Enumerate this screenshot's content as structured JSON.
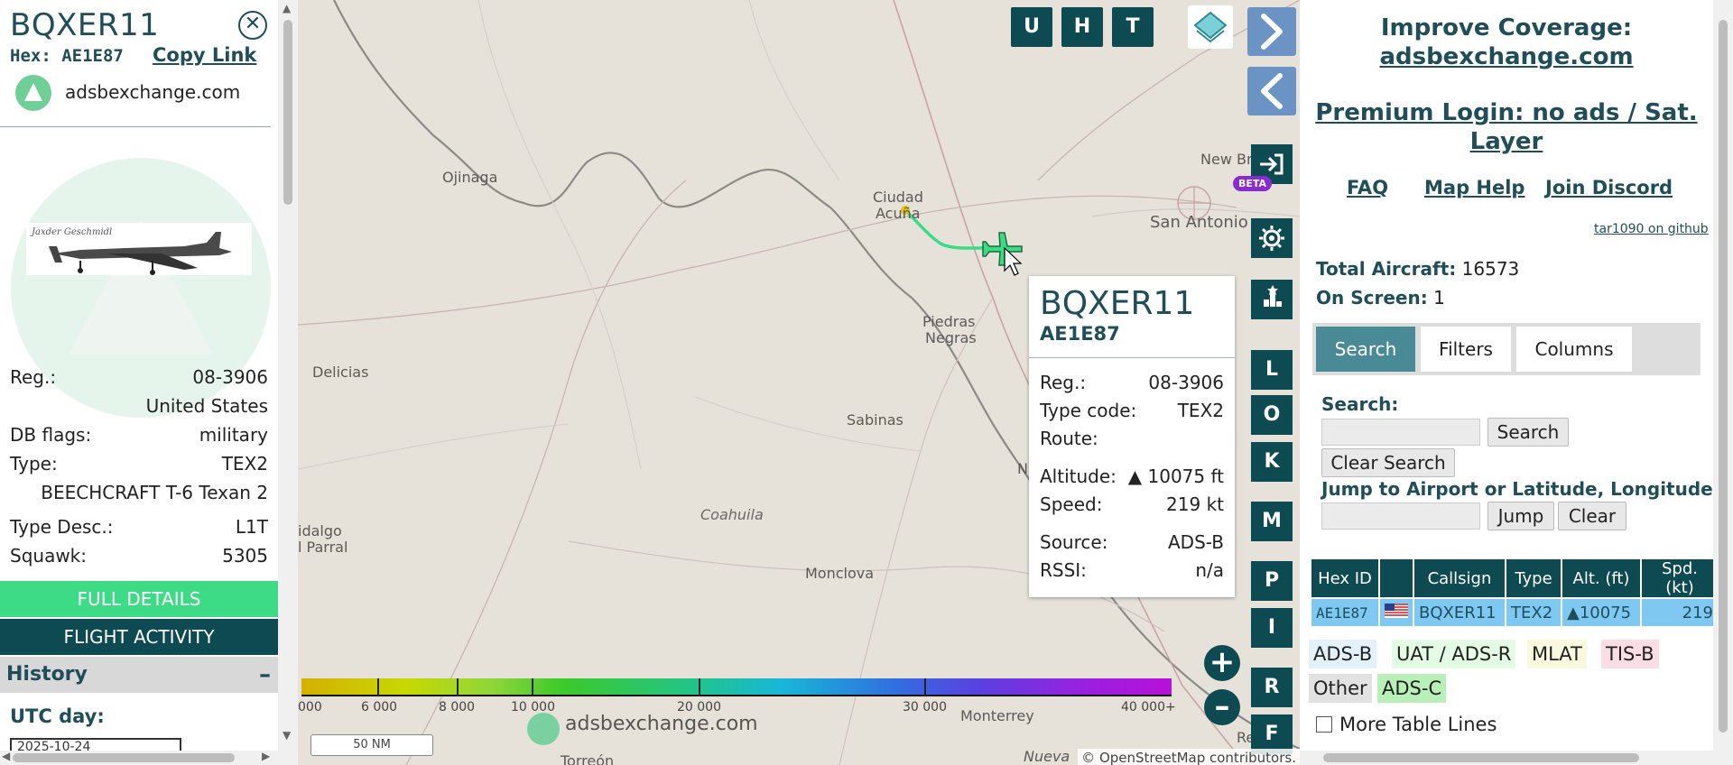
{
  "left_panel": {
    "callsign": "BQXER11",
    "hex_label": "Hex: AE1E87",
    "copy_link": "Copy Link",
    "source_name": "adsbexchange.com",
    "photo_watermark": "Jaxder Geschmidl",
    "rows": [
      {
        "label": "Reg.:",
        "value": "08-3906"
      },
      {
        "label": "",
        "value": "United States"
      },
      {
        "label": "DB flags:",
        "value": "military"
      },
      {
        "label": "Type:",
        "value": "TEX2"
      },
      {
        "label": "",
        "value": "BEECHCRAFT T-6 Texan 2"
      },
      {
        "label": "Type Desc.:",
        "value": "L1T"
      },
      {
        "label": "Squawk:",
        "value": "5305"
      }
    ],
    "full_details": "FULL DETAILS",
    "flight_activity": "FLIGHT ACTIVITY",
    "history": "History",
    "history_toggle": "–",
    "utc_day": "UTC day:",
    "utc_value": "2025-10-24"
  },
  "map": {
    "top_buttons": [
      "U",
      "H",
      "T"
    ],
    "side_buttons": [
      "L",
      "O",
      "K",
      "M",
      "P",
      "I",
      "R",
      "F"
    ],
    "beta": "BETA",
    "zoom_in": "+",
    "zoom_out": "–",
    "cities": [
      "Ojinaga",
      "Ciudad",
      "Acuña",
      "New Brau",
      "San Antonio",
      "Piedras",
      "Negras",
      "Delicias",
      "Sabinas",
      "Monclova",
      "idalgo",
      "l Parral",
      "Monterrey",
      "Reynos",
      "Torreón",
      "Nueva",
      "N"
    ],
    "region": "Coahuila",
    "colorbar_labels": [
      "000",
      "6 000",
      "8 000",
      "10 000",
      "20 000",
      "30 000",
      "40 000+"
    ],
    "scale": "50 NM",
    "watermark": "adsbexchange.com",
    "attribution": "© OpenStreetMap contributors."
  },
  "popup": {
    "callsign": "BQXER11",
    "hex": "AE1E87",
    "rows": [
      {
        "label": "Reg.:",
        "value": "08-3906"
      },
      {
        "label": "Type code:",
        "value": "TEX2"
      },
      {
        "label": "Route:",
        "value": ""
      },
      {
        "label": "Altitude:",
        "value": "▲ 10075 ft"
      },
      {
        "label": "Speed:",
        "value": "219 kt"
      },
      {
        "label": "Source:",
        "value": "ADS-B"
      },
      {
        "label": "RSSI:",
        "value": "n/a"
      }
    ]
  },
  "right_panel": {
    "improve_line1": "Improve Coverage:",
    "improve_line2": "adsbexchange.com",
    "premium_line1": "Premium Login: no ads / Sat.",
    "premium_line2": "Layer",
    "faq": "FAQ",
    "map_help": "Map Help",
    "discord": "Join Discord",
    "github": "tar1090 on github",
    "total_label": "Total Aircraft:",
    "total_value": "16573",
    "onscreen_label": "On Screen:",
    "onscreen_value": "1",
    "tabs": [
      "Search",
      "Filters",
      "Columns"
    ],
    "search_label": "Search:",
    "search_btn": "Search",
    "clear_search": "Clear Search",
    "jump_label": "Jump to Airport or Latitude, Longitude:",
    "jump_btn": "Jump",
    "clear_btn": "Clear",
    "table_headers": [
      "Hex ID",
      "",
      "Callsign",
      "Type",
      "Alt. (ft)",
      "Spd. (kt)"
    ],
    "table_row": [
      "AE1E87",
      "",
      "BQXER11",
      "TEX2",
      "▲10075",
      "219"
    ],
    "chips": [
      "ADS-B",
      "UAT / ADS-R",
      "MLAT",
      "TIS-B",
      "Other",
      "ADS-C"
    ],
    "more_lines": "More Table Lines"
  },
  "colors": {
    "accent": "#0e4a52",
    "highlight": "#3ddb86",
    "row_select": "#7ec8f2",
    "track": "#3ddb86"
  }
}
